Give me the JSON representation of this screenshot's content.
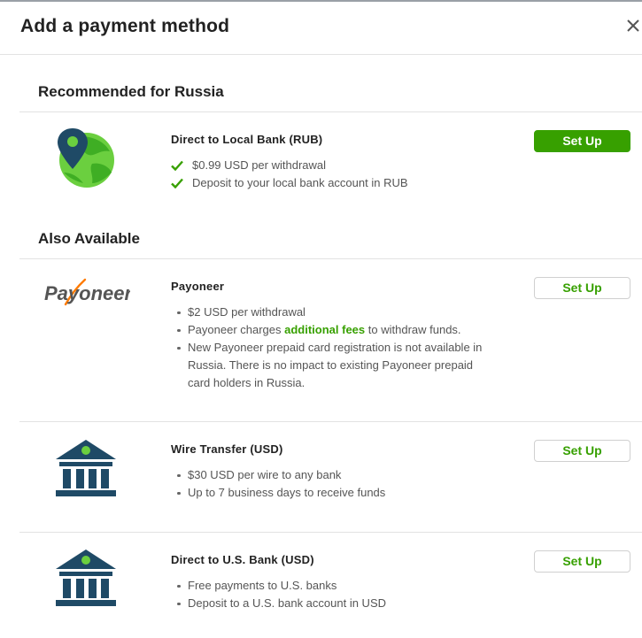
{
  "modal": {
    "title": "Add a payment method",
    "close_icon": "close-icon"
  },
  "sections": {
    "recommended_title": "Recommended for Russia",
    "also_title": "Also Available"
  },
  "methods": {
    "local_bank": {
      "name": "Direct to Local Bank (RUB)",
      "icon": "globe-location-pin-icon",
      "features": [
        "$0.99 USD per withdrawal",
        "Deposit to your local bank account in RUB"
      ],
      "button": "Set Up"
    },
    "payoneer": {
      "name": "Payoneer",
      "logo_text": "Payoneer",
      "features": {
        "f1": "$2 USD per withdrawal",
        "f2_before": "Payoneer charges ",
        "f2_link": "additional fees",
        "f2_after": " to withdraw funds.",
        "f3": "New Payoneer prepaid card registration is not available in Russia. There is no impact to existing Payoneer prepaid card holders in Russia."
      },
      "button": "Set Up"
    },
    "wire": {
      "name": "Wire Transfer (USD)",
      "icon": "bank-icon",
      "features": [
        "$30 USD per wire to any bank",
        "Up to 7 business days to receive funds"
      ],
      "button": "Set Up"
    },
    "us_bank": {
      "name": "Direct to U.S. Bank (USD)",
      "icon": "bank-icon",
      "features": [
        "Free payments to U.S. banks",
        "Deposit to a U.S. bank account in USD"
      ],
      "button": "Set Up"
    }
  },
  "colors": {
    "accent_green": "#37a000",
    "icon_navy": "#1f4a66",
    "globe_green": "#6bcf3f"
  }
}
